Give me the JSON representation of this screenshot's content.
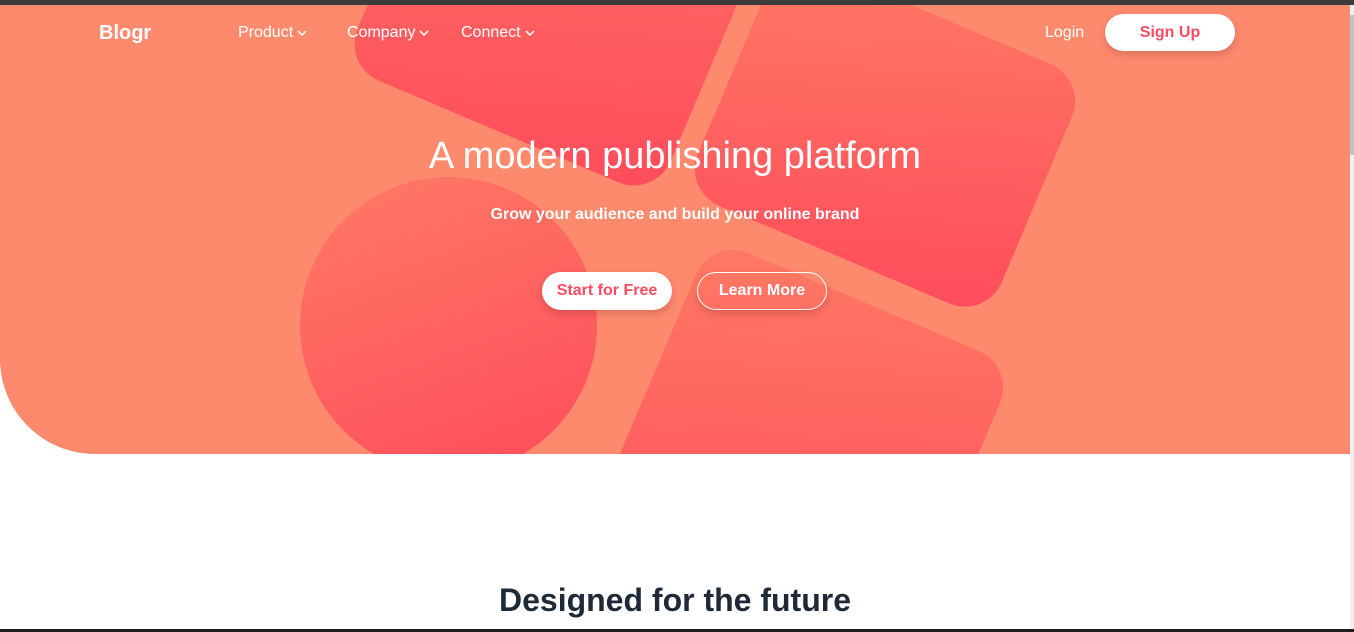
{
  "nav": {
    "logo": "Blogr",
    "items": [
      {
        "label": "Product"
      },
      {
        "label": "Company"
      },
      {
        "label": "Connect"
      }
    ],
    "login_label": "Login",
    "signup_label": "Sign Up"
  },
  "hero": {
    "title": "A modern publishing platform",
    "subtitle": "Grow your audience and build your online brand",
    "primary_cta": "Start for Free",
    "secondary_cta": "Learn More"
  },
  "section": {
    "title": "Designed for the future"
  },
  "icons": {
    "dropdown": "chevron-down-icon"
  },
  "colors": {
    "hero_background": "#fe8a6e",
    "accent": "#ff4b62",
    "heading": "#1f2a38"
  }
}
